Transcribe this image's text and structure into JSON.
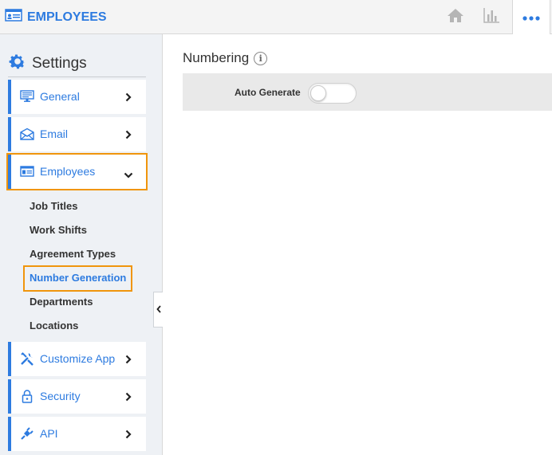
{
  "app": {
    "title": "EMPLOYEES",
    "accent_color": "#2d7be0",
    "highlight_color": "#f0950c"
  },
  "toolbar": {
    "icons": [
      "home-icon",
      "reports-icon",
      "more-icon"
    ]
  },
  "sidebar": {
    "heading": "Settings",
    "items": [
      {
        "label": "General",
        "icon": "monitor-icon",
        "state": "collapsed"
      },
      {
        "label": "Email",
        "icon": "envelope-icon",
        "state": "collapsed"
      },
      {
        "label": "Employees",
        "icon": "id-card-icon",
        "state": "expanded"
      },
      {
        "label": "Customize App",
        "icon": "tools-icon",
        "state": "collapsed"
      },
      {
        "label": "Security",
        "icon": "lock-icon",
        "state": "collapsed"
      },
      {
        "label": "API",
        "icon": "plug-icon",
        "state": "collapsed"
      }
    ],
    "sub_items": [
      {
        "label": "Job Titles"
      },
      {
        "label": "Work Shifts"
      },
      {
        "label": "Agreement Types"
      },
      {
        "label": "Number Generation",
        "active": true
      },
      {
        "label": "Departments"
      },
      {
        "label": "Locations"
      }
    ]
  },
  "main": {
    "title": "Numbering",
    "info_glyph": "i",
    "fields": [
      {
        "label": "Auto Generate",
        "type": "toggle",
        "value": false
      }
    ]
  }
}
